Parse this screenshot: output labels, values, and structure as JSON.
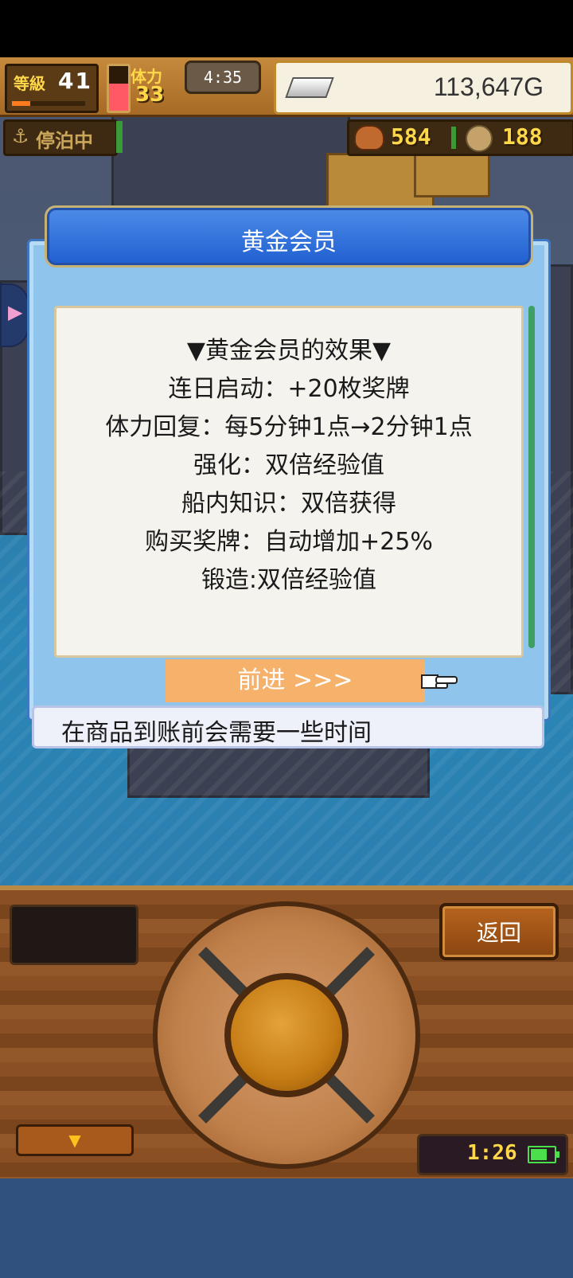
{
  "hud": {
    "level_label": "等級",
    "level_value": "41",
    "level_progress": 0.25,
    "stamina_label": "体力",
    "stamina_value": "33",
    "stamina_fill": 0.6,
    "timer": "4:35",
    "gold": "113,647G",
    "anchor_label": "停泊中",
    "food": "584",
    "coins": "188"
  },
  "modal": {
    "title": "黄金会员",
    "lines": [
      "▼黄金会员的效果▼",
      "连日启动：+20枚奖牌",
      "体力回复：每5分钟1点→2分钟1点",
      "强化：双倍经验值",
      "船内知识：双倍获得",
      "购买奖牌：自动增加+25%",
      "锻造:双倍经验值"
    ],
    "advance_label": "前进 >>>",
    "notice": "在商品到账前会需要一些时间"
  },
  "panel": {
    "back_label": "返回",
    "down_arrow": "▼",
    "clock": "1:26",
    "battery_level": 0.7
  },
  "colors": {
    "accent_orange": "#f6b16a",
    "title_blue": "#2f6fdc",
    "wood": "#8a4f22"
  }
}
